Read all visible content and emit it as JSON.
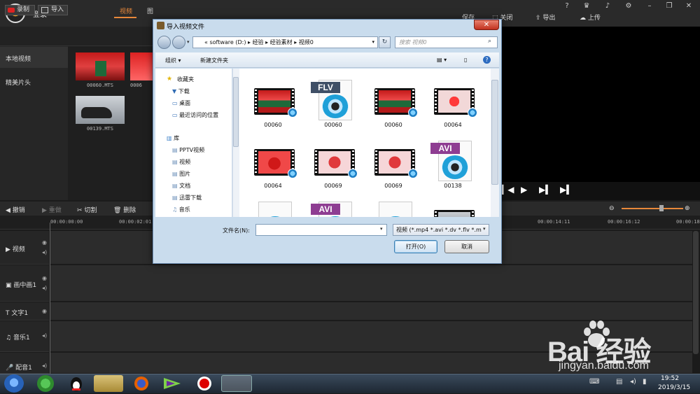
{
  "app": {
    "login": "登录",
    "top_actions": [
      "保存",
      "关闭",
      "导出",
      "上传"
    ],
    "record": "录制",
    "import": "导入",
    "tabs": [
      "视频",
      "图"
    ],
    "side_items": [
      "本地视频",
      "精美片头"
    ],
    "media": [
      {
        "label": "00060.MTS"
      },
      {
        "label": "0006"
      },
      {
        "label": "00139.MTS"
      }
    ],
    "toolbar": [
      "撤销",
      "重做",
      "切割",
      "删除"
    ],
    "ruler_ticks": [
      "00:00:00:00",
      "00:00:02:01",
      "00:00:14:11",
      "00:00:16:12",
      "00:00:18:"
    ],
    "tracks": [
      "视频",
      "画中画1",
      "文字1",
      "音乐1",
      "配音1"
    ]
  },
  "dialog": {
    "title": "导入视频文件",
    "close": "✕",
    "address": [
      "«",
      "software (D:)",
      "▸",
      "经验",
      "▸",
      "经验素材",
      "▸",
      "视频0"
    ],
    "search_placeholder": "搜索 视频0",
    "cmd_organize": "组织 ▾",
    "cmd_new_folder": "新建文件夹",
    "nav": {
      "favorites": "收藏夹",
      "fav_items": [
        "下载",
        "桌面",
        "最近访问的位置"
      ],
      "library": "库",
      "lib_items": [
        "PPTV视频",
        "视频",
        "图片",
        "文档",
        "迅雷下载",
        "音乐"
      ]
    },
    "files": [
      {
        "name": "00060",
        "kind": "film",
        "scene": "gate"
      },
      {
        "name": "00060",
        "kind": "doc",
        "tag": "FLV",
        "tag_color": "#3f4f66"
      },
      {
        "name": "00060",
        "kind": "film",
        "scene": "gate"
      },
      {
        "name": "00064",
        "kind": "film",
        "scene": "xi"
      },
      {
        "name": "00064",
        "kind": "film",
        "scene": "xi2"
      },
      {
        "name": "00069",
        "kind": "film",
        "scene": "flower"
      },
      {
        "name": "00069",
        "kind": "film",
        "scene": "flower"
      },
      {
        "name": "00138",
        "kind": "doc",
        "tag": "AVI",
        "tag_color": "#8e3d92"
      },
      {
        "name": "",
        "kind": "doc",
        "tag": "",
        "tag_color": "#3f4f66"
      },
      {
        "name": "",
        "kind": "doc",
        "tag": "AVI",
        "tag_color": "#8e3d92"
      },
      {
        "name": "",
        "kind": "doc",
        "tag": "",
        "tag_color": "#3f4f66"
      },
      {
        "name": "",
        "kind": "film",
        "scene": "car"
      }
    ],
    "filename_label": "文件名(N):",
    "filename_value": "",
    "filetype": "视频 (*.mp4 *.avi *.dv *.flv *.m",
    "open": "打开(O)",
    "cancel": "取消"
  },
  "taskbar": {
    "time": "19:52",
    "date": "2019/3/15"
  },
  "watermark": {
    "brand": "Bai  经验",
    "url": "jingyan.baidu.com"
  },
  "colors": {
    "accent": "#e8883a",
    "dialog_bg": "#c9dced"
  }
}
